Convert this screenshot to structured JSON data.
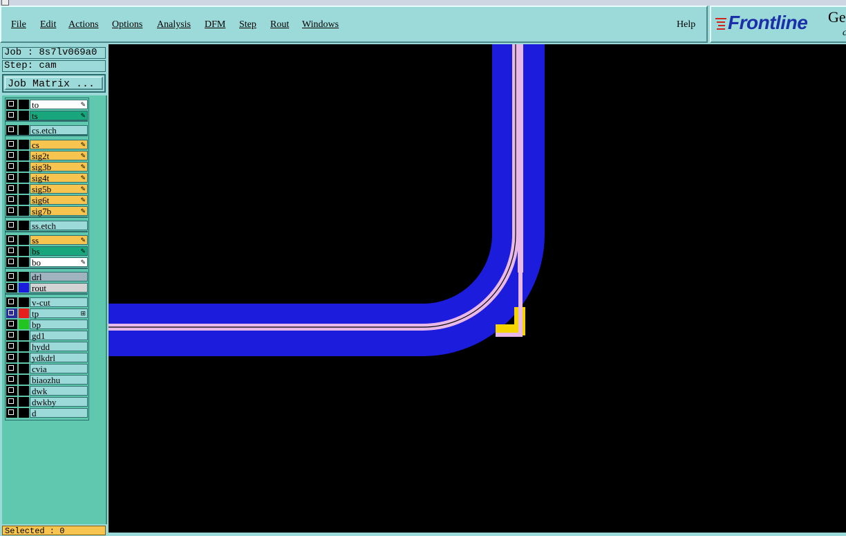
{
  "menu": {
    "items": [
      "File",
      "Edit",
      "Actions",
      "Options",
      "Analysis",
      "DFM",
      "Step",
      "Rout",
      "Windows"
    ],
    "help": "Help"
  },
  "logo": {
    "brand": "Frontline",
    "partial_text": "Ge",
    "partial_sub": "c"
  },
  "job": {
    "label": "Job : 8s7lv069a0",
    "step": "Step: cam"
  },
  "job_matrix_button": "Job Matrix ...",
  "layers": [
    {
      "name": "to",
      "color": "#ffffff",
      "swatch": "#000000",
      "flag": true,
      "group": 1
    },
    {
      "name": "ts",
      "color": "#1aa67d",
      "swatch": "#000000",
      "flag": true,
      "group": 1
    },
    {
      "name": "cs.etch",
      "color": "#9cdada",
      "swatch": "#000000",
      "flag": false,
      "group": 2
    },
    {
      "name": "cs",
      "color": "#f7c44f",
      "swatch": "#000000",
      "flag": true,
      "group": 3
    },
    {
      "name": "sig2t",
      "color": "#f7c44f",
      "swatch": "#000000",
      "flag": true,
      "group": 3
    },
    {
      "name": "sig3b",
      "color": "#f7c44f",
      "swatch": "#000000",
      "flag": true,
      "group": 3
    },
    {
      "name": "sig4t",
      "color": "#f7c44f",
      "swatch": "#000000",
      "flag": true,
      "group": 3
    },
    {
      "name": "sig5b",
      "color": "#f7c44f",
      "swatch": "#000000",
      "flag": true,
      "group": 3
    },
    {
      "name": "sig6t",
      "color": "#f7c44f",
      "swatch": "#000000",
      "flag": true,
      "group": 3
    },
    {
      "name": "sig7b",
      "color": "#f7c44f",
      "swatch": "#000000",
      "flag": true,
      "group": 3
    },
    {
      "name": "ss.etch",
      "color": "#9cdada",
      "swatch": "#000000",
      "flag": false,
      "group": 4
    },
    {
      "name": "ss",
      "color": "#f7c44f",
      "swatch": "#000000",
      "flag": true,
      "group": 5
    },
    {
      "name": "bs",
      "color": "#1aa67d",
      "swatch": "#000000",
      "flag": true,
      "group": 5
    },
    {
      "name": "bo",
      "color": "#ffffff",
      "swatch": "#000000",
      "flag": true,
      "group": 5
    },
    {
      "name": "drl",
      "color": "#9fb4bf",
      "swatch": "#000000",
      "flag": false,
      "group": 6
    },
    {
      "name": "rout",
      "color": "#d3d3d3",
      "swatch": "#1c1cdc",
      "flag": false,
      "group": 6
    },
    {
      "name": "v-cut",
      "color": "#9cdada",
      "swatch": "#000000",
      "flag": false,
      "group": 7
    },
    {
      "name": "tp",
      "color": "#9cdada",
      "swatch": "#e61e1e",
      "flag": true,
      "group": 7,
      "active": true
    },
    {
      "name": "bp",
      "color": "#9cdada",
      "swatch": "#22c422",
      "flag": false,
      "group": 7
    },
    {
      "name": "gd1",
      "color": "#9cdada",
      "swatch": "#000000",
      "flag": false,
      "group": 7
    },
    {
      "name": "hydd",
      "color": "#9cdada",
      "swatch": "#000000",
      "flag": false,
      "group": 7
    },
    {
      "name": "ydkdrl",
      "color": "#9cdada",
      "swatch": "#000000",
      "flag": false,
      "group": 7
    },
    {
      "name": "cvia",
      "color": "#9cdada",
      "swatch": "#000000",
      "flag": false,
      "group": 7
    },
    {
      "name": "biaozhu",
      "color": "#9cdada",
      "swatch": "#000000",
      "flag": false,
      "group": 7
    },
    {
      "name": "dwk",
      "color": "#9cdada",
      "swatch": "#000000",
      "flag": false,
      "group": 7
    },
    {
      "name": "dwkby",
      "color": "#9cdada",
      "swatch": "#000000",
      "flag": false,
      "group": 7
    },
    {
      "name": "d",
      "color": "#9cdada",
      "swatch": "#000000",
      "flag": false,
      "group": 7
    }
  ],
  "status": {
    "selected": "Selected : 0"
  },
  "canvas": {
    "background": "#000000",
    "rout_color": "#1c1cdc",
    "path_color": "#e8b8e8",
    "highlight_color": "#f5d400"
  }
}
